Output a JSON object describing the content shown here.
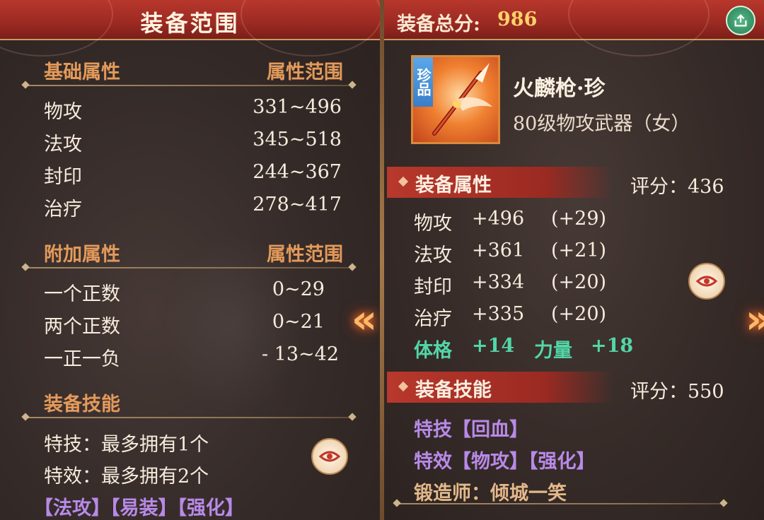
{
  "left": {
    "title": "装备范围",
    "base": {
      "header": "基础属性",
      "range_header": "属性范围",
      "rows": [
        {
          "name": "物攻",
          "range": "331~496"
        },
        {
          "name": "法攻",
          "range": "345~518"
        },
        {
          "name": "封印",
          "range": "244~367"
        },
        {
          "name": "治疗",
          "range": "278~417"
        }
      ]
    },
    "extra": {
      "header": "附加属性",
      "range_header": "属性范围",
      "rows": [
        {
          "name": "一个正数",
          "range": "0~29"
        },
        {
          "name": "两个正数",
          "range": "0~21"
        },
        {
          "name": "一正一负",
          "range": "- 13~42"
        }
      ]
    },
    "skills": {
      "header": "装备技能",
      "line1": "特技：最多拥有1个",
      "line2": "特效：最多拥有2个",
      "tags": "【法攻】【易装】【强化】"
    }
  },
  "right": {
    "score_label": "装备总分:",
    "score_value": "986",
    "item": {
      "tag": "珍品",
      "name": "火麟枪·珍",
      "subtitle": "80级物攻武器（女）"
    },
    "attrs": {
      "header": "装备属性",
      "score": "评分：436",
      "rows": [
        {
          "name": "物攻",
          "value": "+496",
          "bonus": "(+29)"
        },
        {
          "name": "法攻",
          "value": "+361",
          "bonus": "(+21)"
        },
        {
          "name": "封印",
          "value": "+334",
          "bonus": "(+20)"
        },
        {
          "name": "治疗",
          "value": "+335",
          "bonus": "(+20)"
        }
      ],
      "extra1_name": "体格",
      "extra1_value": "+14",
      "extra2_name": "力量",
      "extra2_value": "+18"
    },
    "skills": {
      "header": "装备技能",
      "score": "评分：550",
      "skill": "特技【回血】",
      "effect": "特效【物攻】【强化】",
      "forger": "锻造师：倾城一笑"
    }
  },
  "colors": {
    "accent_red": "#9b2a22",
    "section_orange": "#e39a5a",
    "purple": "#b88ae8",
    "green": "#52d6a8",
    "score_gold": "#ffd36a"
  },
  "icons": [
    "eye-icon",
    "nav-left-arrow-icon",
    "nav-right-arrow-icon",
    "share-icon",
    "spear-weapon-icon"
  ]
}
